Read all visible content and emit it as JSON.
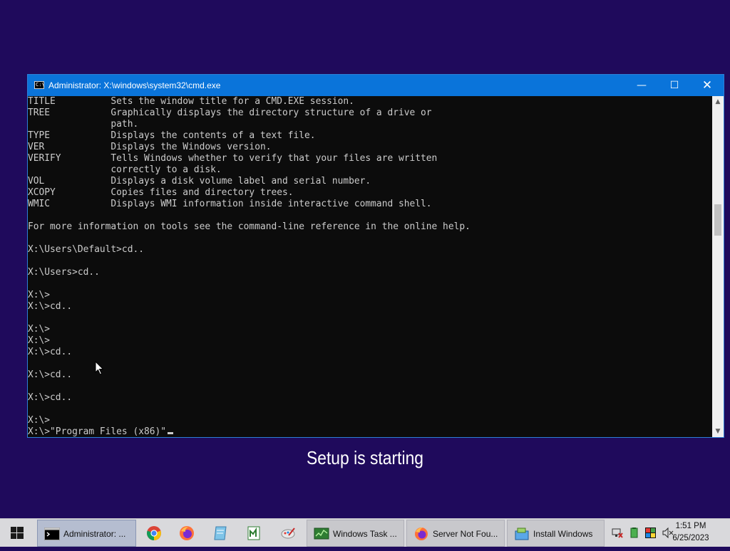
{
  "window": {
    "title": "Administrator: X:\\windows\\system32\\cmd.exe",
    "icon_label": "C:\\",
    "minimize": "—",
    "maximize": "☐",
    "close": "✕"
  },
  "console": {
    "lines": [
      "TITLE          Sets the window title for a CMD.EXE session.",
      "TREE           Graphically displays the directory structure of a drive or",
      "               path.",
      "TYPE           Displays the contents of a text file.",
      "VER            Displays the Windows version.",
      "VERIFY         Tells Windows whether to verify that your files are written",
      "               correctly to a disk.",
      "VOL            Displays a disk volume label and serial number.",
      "XCOPY          Copies files and directory trees.",
      "WMIC           Displays WMI information inside interactive command shell.",
      "",
      "For more information on tools see the command-line reference in the online help.",
      "",
      "X:\\Users\\Default>cd..",
      "",
      "X:\\Users>cd..",
      "",
      "X:\\>",
      "X:\\>cd..",
      "",
      "X:\\>",
      "X:\\>",
      "X:\\>cd..",
      "",
      "X:\\>cd..",
      "",
      "X:\\>cd..",
      "",
      "X:\\>"
    ],
    "current_input": "X:\\>\"Program Files (x86)\""
  },
  "scrollbar": {
    "up": "▲",
    "down": "▼"
  },
  "setup_status": "Setup is starting",
  "taskbar": {
    "start_icon": "windows-logo-icon",
    "tasks": [
      {
        "label": "Administrator: ...",
        "icon": "cmd-icon",
        "active": true
      },
      {
        "label": "Windows Task ...",
        "icon": "task-manager-icon",
        "active": false
      },
      {
        "label": "Server Not Fou...",
        "icon": "firefox-icon",
        "active": false
      },
      {
        "label": "Install Windows",
        "icon": "install-windows-icon",
        "active": false
      }
    ],
    "pinned": [
      "chrome-icon",
      "firefox-icon",
      "notepad-icon",
      "notepad-plus-icon",
      "paint-icon"
    ],
    "tray": [
      "network-icon",
      "battery-icon",
      "color-icon",
      "volume-muted-icon"
    ],
    "clock": {
      "time": "1:51 PM",
      "date": "6/25/2023"
    }
  },
  "colors": {
    "desktop": "#1f0a5c",
    "titlebar": "#0a74da",
    "console_bg": "#0c0c0c",
    "console_text": "#cccccc",
    "taskbar": "#d9d9dc"
  }
}
